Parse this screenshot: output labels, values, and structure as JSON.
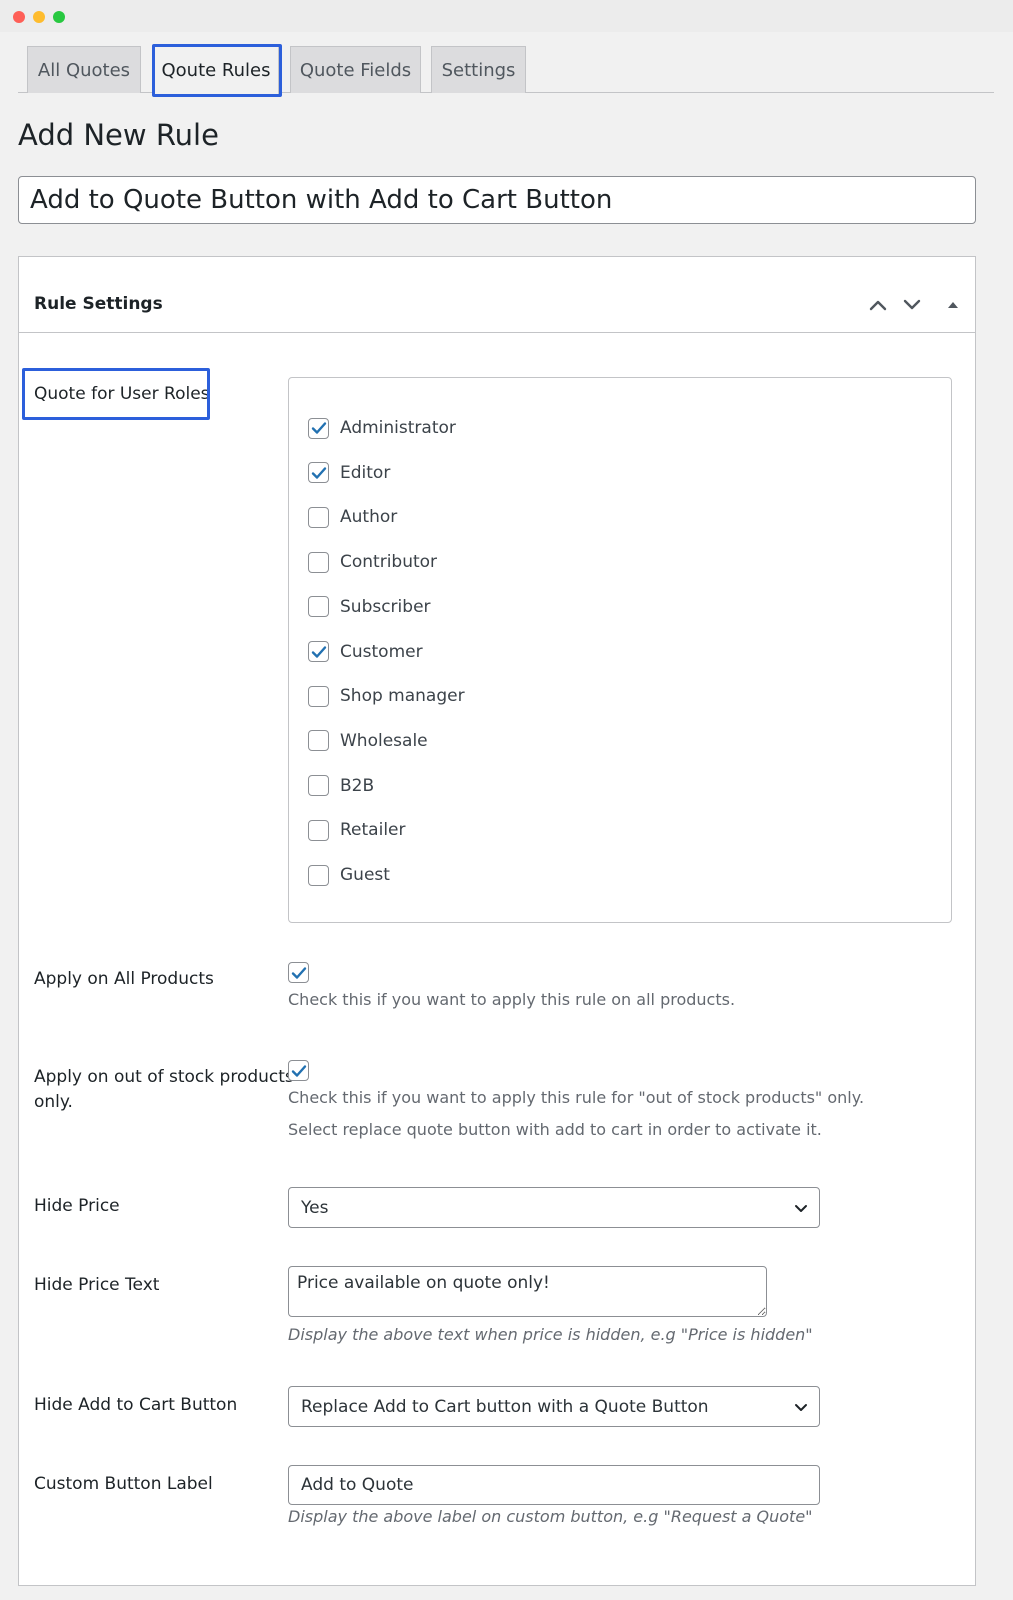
{
  "tabs": [
    {
      "label": "All Quotes"
    },
    {
      "label": "Qoute Rules"
    },
    {
      "label": "Quote Fields"
    },
    {
      "label": "Settings"
    }
  ],
  "page": {
    "title": "Add New Rule",
    "rule_title_value": "Add to Quote Button with Add to Cart Button"
  },
  "panel": {
    "title": "Rule Settings",
    "header_icons": [
      "chevron-up-icon",
      "chevron-down-icon",
      "triangle-up-icon"
    ]
  },
  "user_roles": {
    "label": "Quote for User Roles",
    "roles": [
      {
        "label": "Administrator",
        "checked": true
      },
      {
        "label": "Editor",
        "checked": true
      },
      {
        "label": "Author",
        "checked": false
      },
      {
        "label": "Contributor",
        "checked": false
      },
      {
        "label": "Subscriber",
        "checked": false
      },
      {
        "label": "Customer",
        "checked": true
      },
      {
        "label": "Shop manager",
        "checked": false
      },
      {
        "label": "Wholesale",
        "checked": false
      },
      {
        "label": "B2B",
        "checked": false
      },
      {
        "label": "Retailer",
        "checked": false
      },
      {
        "label": "Guest",
        "checked": false
      }
    ]
  },
  "apply_all": {
    "label": "Apply on All Products",
    "checked": true,
    "help": "Check this if you want to apply this rule on all products."
  },
  "apply_out_of_stock": {
    "label_line1": "Apply on out of stock products",
    "label_line2": "only.",
    "checked": true,
    "help_line1": "Check this if you want to apply this rule for \"out of stock products\" only.",
    "help_line2": "Select replace quote button with add to cart in order to activate it."
  },
  "hide_price": {
    "label": "Hide Price",
    "selected": "Yes"
  },
  "hide_price_text": {
    "label": "Hide Price Text",
    "value": "Price available on quote only!",
    "help": "Display the above text when price is hidden, e.g \"Price is hidden\""
  },
  "hide_add_to_cart": {
    "label": "Hide Add to Cart Button",
    "selected": "Replace Add to Cart button with a Quote Button"
  },
  "custom_button_label": {
    "label": "Custom Button Label",
    "value": "Add to Quote",
    "help": "Display the above label on custom button, e.g \"Request a Quote\""
  },
  "colors": {
    "highlight": "#2c5fdb",
    "checkmark": "#2271b1"
  }
}
